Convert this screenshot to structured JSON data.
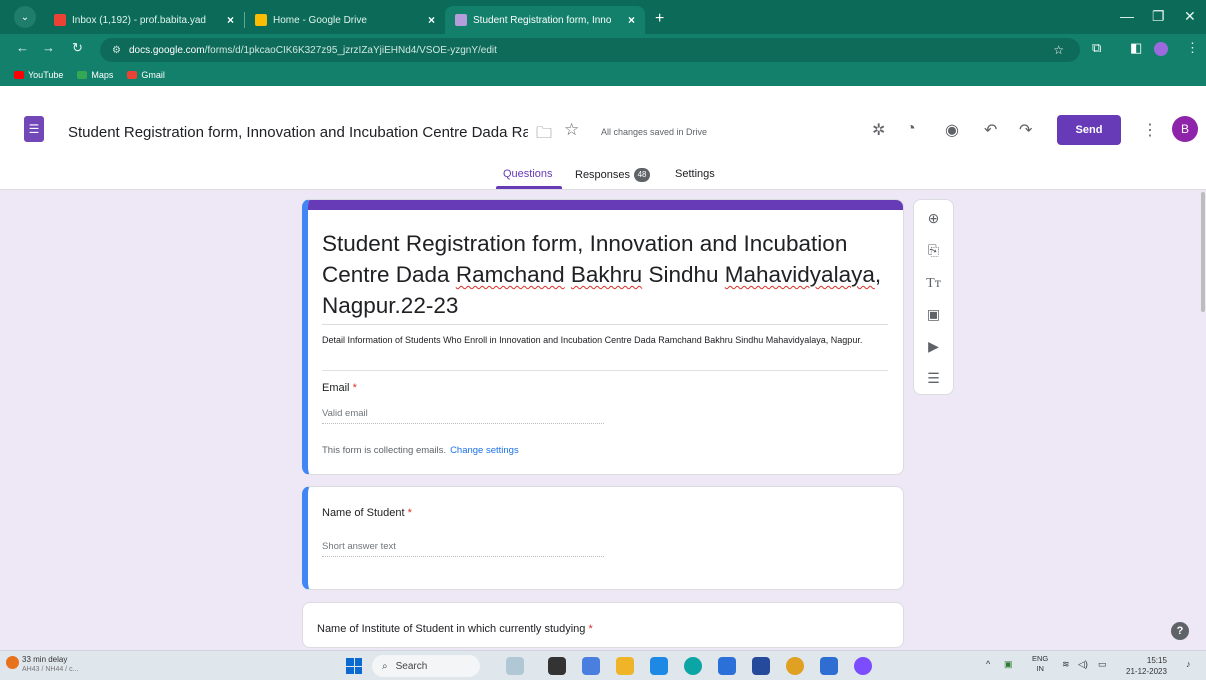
{
  "browser": {
    "tabs": [
      {
        "title": "Inbox (1,192) - prof.babita.yad",
        "active": false
      },
      {
        "title": "Home - Google Drive",
        "active": false
      },
      {
        "title": "Student Registration form, Inno",
        "active": true
      }
    ],
    "url_host": "docs.google.com",
    "url_path": "/forms/d/1pkcaoCIK6K327z95_jzrzIZaYjiEHNd4/VSOE-yzgnY/edit",
    "bookmarks": [
      "YouTube",
      "Maps",
      "Gmail"
    ]
  },
  "form_header": {
    "doc_title": "Student Registration form, Innovation and Incubation Centre Dada Ramch",
    "saved_status": "All changes saved in Drive",
    "send_label": "Send",
    "avatar_initial": "B",
    "tabs": {
      "questions": "Questions",
      "responses": "Responses",
      "responses_count": "48",
      "settings": "Settings"
    }
  },
  "form": {
    "title_part1": "Student Registration form, Innovation and Incubation Centre Dada ",
    "title_sq1": "Ramchand",
    "title_space": " ",
    "title_sq2": "Bakhru",
    "title_part2": " Sindhu ",
    "title_sq3": "Mahavidyalaya",
    "title_part3": ", Nagpur.22-23",
    "description": "Detail Information of Students Who Enroll in Innovation and Incubation Centre Dada Ramchand Bakhru Sindhu Mahavidyalaya, Nagpur.",
    "email_label": "Email",
    "required_mark": "*",
    "email_placeholder": "Valid email",
    "collecting_note": "This form is collecting emails.",
    "change_settings": "Change settings"
  },
  "questions": [
    {
      "label": "Name of Student",
      "placeholder": "Short answer text"
    },
    {
      "label": "Name of Institute of Student in which currently studying"
    }
  ],
  "taskbar": {
    "weather_title": "33 min delay",
    "weather_sub": "AH43 / NH44 / c...",
    "search_label": "Search",
    "lang": "ENG",
    "region": "IN",
    "time": "15:15",
    "date": "21-12-2023"
  },
  "colors": {
    "browser_frame": "#12806b",
    "forms_accent": "#673ab7",
    "selected_card_border": "#4285f4"
  }
}
